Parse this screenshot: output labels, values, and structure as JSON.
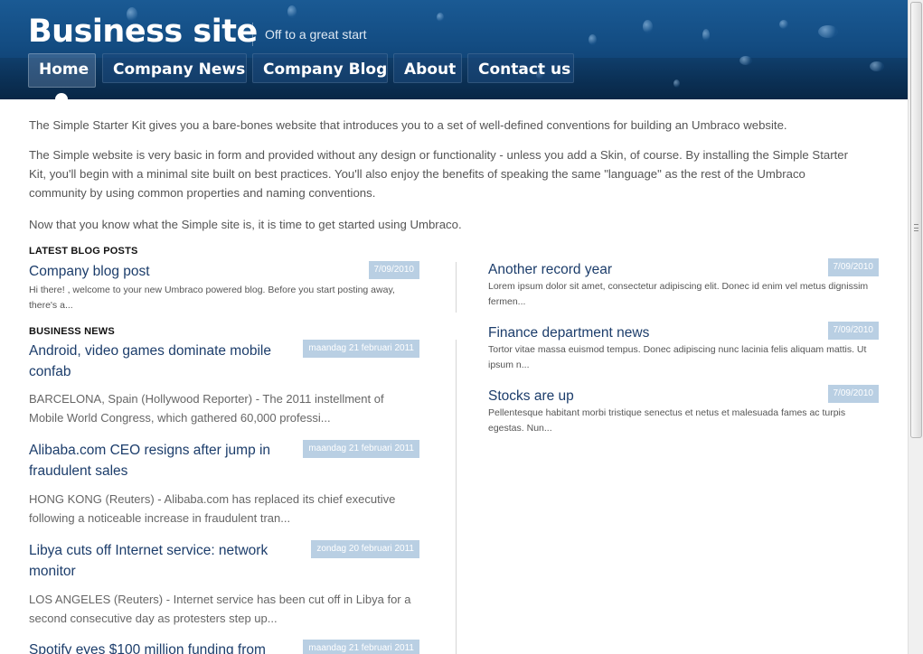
{
  "header": {
    "site_title": "Business site",
    "tagline": "Off to a great start",
    "nav": [
      {
        "label": "Home",
        "active": true
      },
      {
        "label": "Company News",
        "active": false
      },
      {
        "label": "Company Blog",
        "active": false
      },
      {
        "label": "About",
        "active": false
      },
      {
        "label": "Contact us",
        "active": false
      }
    ]
  },
  "intro": {
    "p1": "The Simple Starter Kit gives you a bare-bones website that introduces you to a set of well-defined conventions for building an Umbraco website.",
    "p2": "The Simple website is very basic in form and provided without any design or functionality - unless you add a Skin, of course. By installing the Simple Starter Kit, you'll begin with a minimal site built on best practices. You'll also enjoy the benefits of speaking the same \"language\" as the rest of the Umbraco community by using common properties and naming conventions.",
    "p3": "Now that you know what the Simple site is, it is time to get started using Umbraco."
  },
  "latest_blog": {
    "heading": "LATEST BLOG POSTS",
    "items": [
      {
        "title": "Company blog post",
        "date": "7/09/2010",
        "excerpt": "Hi there! , welcome to your new Umbraco powered blog. Before you start posting away, there's a..."
      }
    ]
  },
  "business_news": {
    "heading": "BUSINESS NEWS",
    "items": [
      {
        "title": "Android, video games dominate mobile confab",
        "date": "maandag 21 februari 2011",
        "excerpt": "BARCELONA, Spain (Hollywood Reporter) - The 2011 instellment of Mobile World Congress, which gathered 60,000 professi..."
      },
      {
        "title": "Alibaba.com CEO resigns after jump in fraudulent sales",
        "date": "maandag 21 februari 2011",
        "excerpt": "HONG KONG (Reuters) - Alibaba.com has replaced its chief executive following a noticeable increase in fraudulent tran..."
      },
      {
        "title": "Libya cuts off Internet service: network monitor",
        "date": "zondag 20 februari 2011",
        "excerpt": "LOS ANGELES (Reuters) - Internet service has been cut off in Libya for a second consecutive day as protesters step up..."
      },
      {
        "title": "Spotify eyes $100 million funding from",
        "date": "maandag 21 februari 2011",
        "excerpt": ""
      }
    ]
  },
  "company_news": {
    "items": [
      {
        "title": "Another record year",
        "date": "7/09/2010",
        "excerpt": "Lorem ipsum dolor sit amet, consectetur adipiscing elit. Donec id enim vel metus dignissim fermen..."
      },
      {
        "title": "Finance department news",
        "date": "7/09/2010",
        "excerpt": "Tortor vitae massa euismod tempus. Donec adipiscing nunc lacinia felis aliquam mattis. Ut ipsum n..."
      },
      {
        "title": "Stocks are up",
        "date": "7/09/2010",
        "excerpt": "Pellentesque habitant morbi tristique senectus et netus et malesuada fames ac turpis egestas. Nun..."
      }
    ]
  },
  "colors": {
    "header_blue": "#134c82",
    "link_blue": "#1c3d6b",
    "date_badge": "#b9cfe3"
  }
}
